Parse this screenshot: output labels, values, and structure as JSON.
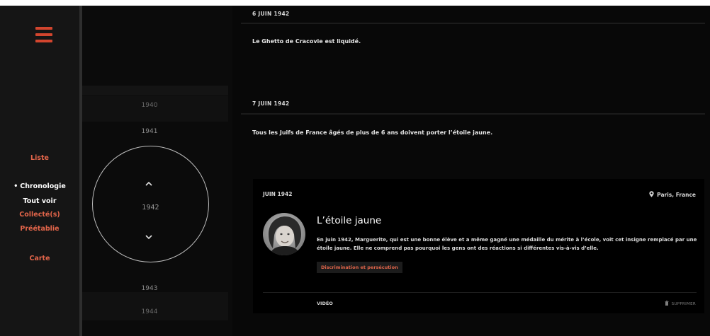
{
  "sidebar": {
    "items": [
      {
        "label": "Liste",
        "active": false
      },
      {
        "label": "Chronologie",
        "active": true
      },
      {
        "label": "Tout voir",
        "active": false
      },
      {
        "label": "Collecté(s)",
        "active": false
      },
      {
        "label": "Préétablie",
        "active": false
      },
      {
        "label": "Carte",
        "active": false
      }
    ],
    "bullet": "•"
  },
  "timeline": {
    "years": [
      "1940",
      "1941",
      "1942",
      "1943",
      "1944"
    ],
    "selected": "1942"
  },
  "events": [
    {
      "date": "6 JUIN 1942",
      "text": "Le Ghetto de Cracovie est liquidé."
    },
    {
      "date": "7 JUIN 1942",
      "text": "Tous les Juifs de France âgés de plus de 6 ans doivent porter l’étoile jaune."
    }
  ],
  "card": {
    "date": "JUIN 1942",
    "location": "Paris, France",
    "title": "L’étoile jaune",
    "description": "En juin 1942, Marguerite, qui est une bonne élève et a même gagné une médaille du mérite à l’école, voit cet insigne remplacé par une étoile jaune. Elle ne comprend pas pourquoi les gens ont des réactions si différentes vis-à-vis d’elle.",
    "tag": "Discrimination et persécution",
    "media": "VIDÉO",
    "remove": "SUPPRIMER"
  },
  "colors": {
    "accent": "#e2654a",
    "hamburger": "#d2452e"
  }
}
